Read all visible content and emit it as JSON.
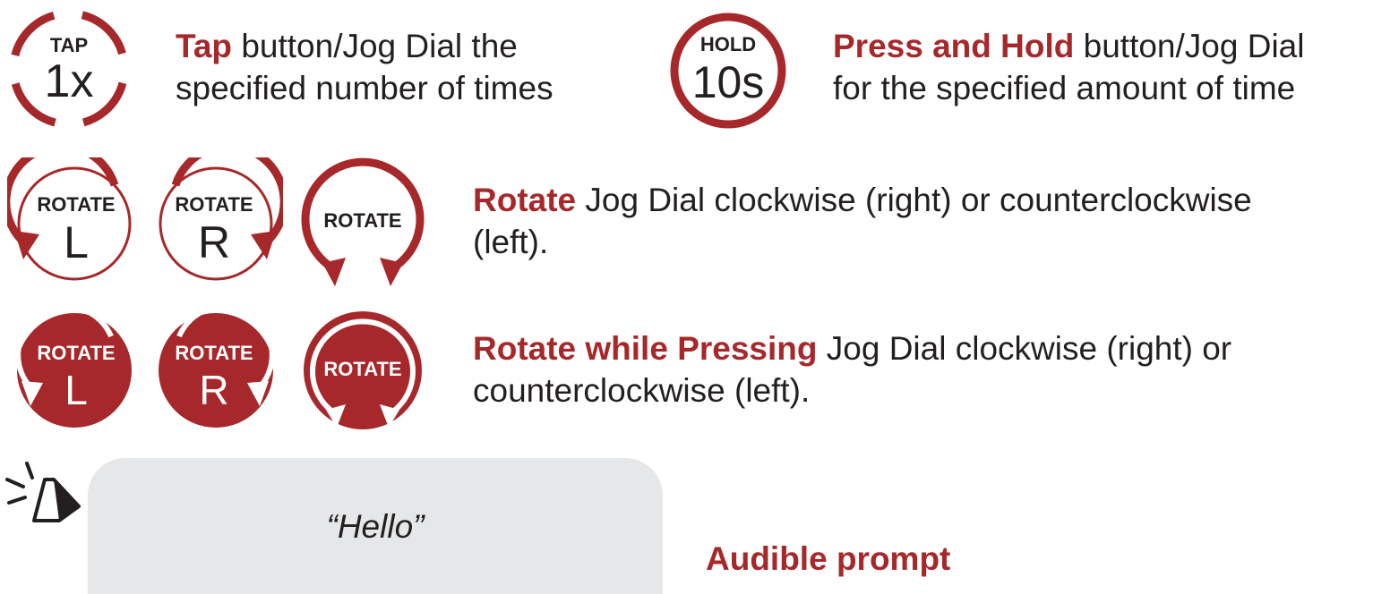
{
  "colors": {
    "accent": "#a6282a",
    "text": "#231f20",
    "bubble": "#e6e7e8"
  },
  "tap": {
    "icon": "tap-1x-icon",
    "small": "TAP",
    "big": "1x",
    "key": "Tap",
    "line1_rest": " button/Jog Dial the",
    "line2": "specified number of times"
  },
  "hold": {
    "icon": "hold-10s-icon",
    "small": "HOLD",
    "big": "10s",
    "key": "Press and Hold",
    "line1_rest": " button/Jog Dial",
    "line2": "for the specified amount of time"
  },
  "rotate": {
    "icons": [
      {
        "name": "rotate-left-icon",
        "label": "ROTATE",
        "letter": "L"
      },
      {
        "name": "rotate-right-icon",
        "label": "ROTATE",
        "letter": "R"
      },
      {
        "name": "rotate-both-icon",
        "label": "ROTATE",
        "letter": ""
      }
    ],
    "key": "Rotate",
    "line1_rest": " Jog Dial clockwise (right) or counterclockwise",
    "line2": "(left)."
  },
  "rotate_press": {
    "icons": [
      {
        "name": "rotate-press-left-icon",
        "label": "ROTATE",
        "letter": "L"
      },
      {
        "name": "rotate-press-right-icon",
        "label": "ROTATE",
        "letter": "R"
      },
      {
        "name": "rotate-press-both-icon",
        "label": "ROTATE",
        "letter": ""
      }
    ],
    "key": "Rotate while Pressing",
    "line1_rest": " Jog Dial clockwise (right) or",
    "line2": "counterclockwise (left)."
  },
  "audible": {
    "icon": "speaker-icon",
    "quote": "“Hello”",
    "label": "Audible prompt"
  }
}
